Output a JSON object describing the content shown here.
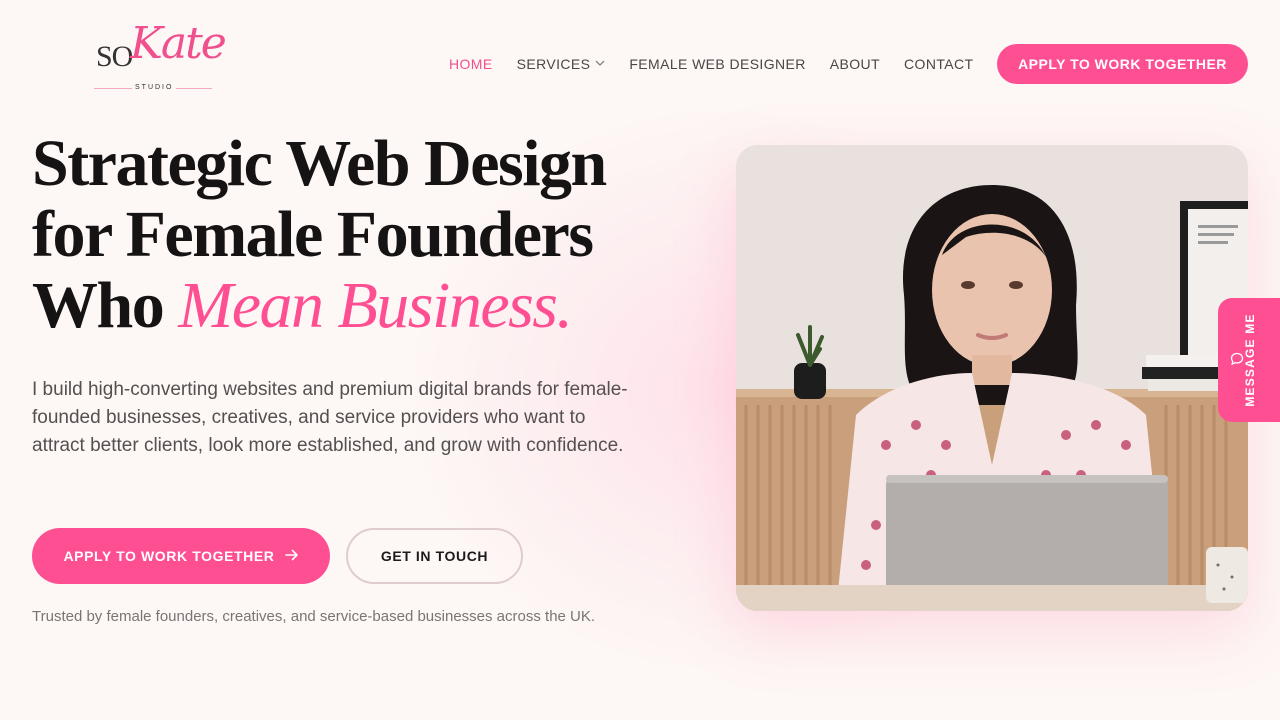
{
  "brand": {
    "logo_so": "SO",
    "logo_kate": "Kate",
    "logo_studio": "STUDIO",
    "accent_color": "#ff4f93"
  },
  "nav": {
    "items": [
      {
        "label": "HOME",
        "active": true
      },
      {
        "label": "SERVICES",
        "has_dropdown": true
      },
      {
        "label": "FEMALE WEB DESIGNER"
      },
      {
        "label": "ABOUT"
      },
      {
        "label": "CONTACT"
      }
    ],
    "cta_label": "APPLY TO WORK TOGETHER"
  },
  "hero": {
    "title_line1": "Strategic Web Design",
    "title_line2": "for Female Founders",
    "title_line3_prefix": "Who ",
    "title_accent": "Mean Business.",
    "subtitle": "I build high-converting websites and premium digital brands for female-founded businesses, creatives, and service providers who want to attract better clients, look more established, and grow with confidence.",
    "primary_cta": "APPLY TO WORK TOGETHER",
    "secondary_cta": "GET IN TOUCH",
    "trusted": "Trusted by female founders, creatives, and service-based businesses across the UK."
  },
  "side_tab": {
    "label": "MESSAGE ME",
    "icon": "chat-bubble-icon"
  }
}
